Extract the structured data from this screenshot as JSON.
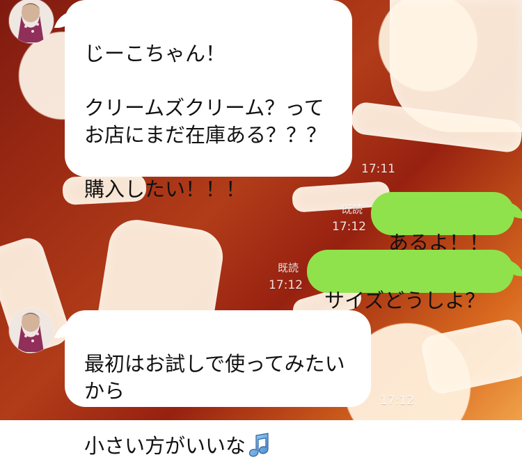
{
  "chat": {
    "messages": [
      {
        "side": "incoming",
        "text": "じーこちゃん！\n\nクリームズクリーム？って\nお店にまだ在庫ある？？？\n\n購入したい！！！",
        "time": "17:11"
      },
      {
        "side": "outgoing",
        "text": "あるよ！！",
        "read": "既読",
        "time": "17:12"
      },
      {
        "side": "outgoing",
        "text": "サイズどうしよ？",
        "read": "既読",
        "time": "17:12"
      },
      {
        "side": "incoming",
        "text": "最初はお試しで使ってみたい\nから\n小さい方がいいな",
        "time": "17:12",
        "emoji": "music-note-icon"
      }
    ]
  },
  "colors": {
    "incoming_bubble": "#ffffff",
    "outgoing_bubble": "#8fe24b",
    "meta_text": "#ffffff"
  }
}
